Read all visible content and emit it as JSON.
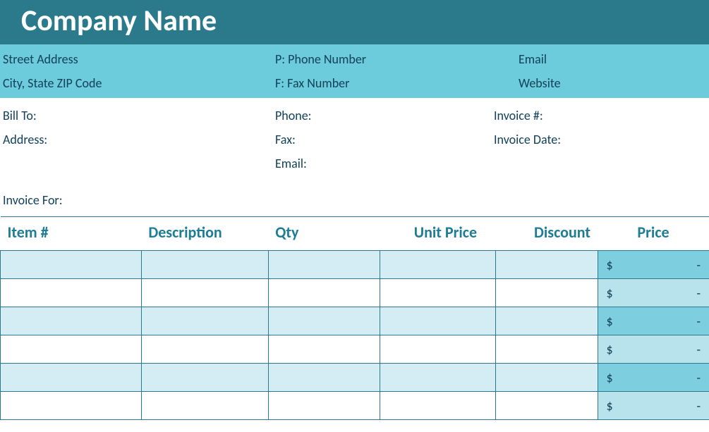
{
  "header": {
    "company": "Company Name"
  },
  "info": {
    "street": "Street Address",
    "phone": "P: Phone Number",
    "email": "Email",
    "city": "City, State ZIP Code",
    "fax": "F: Fax Number",
    "website": "Website"
  },
  "billto": {
    "billto": "Bill To:",
    "phone": "Phone:",
    "invoice_no": "Invoice #:",
    "address": "Address:",
    "fax": "Fax:",
    "invoice_date": "Invoice Date:",
    "email": "Email:"
  },
  "invoice_for": "Invoice For:",
  "table": {
    "headers": {
      "item": "Item #",
      "description": "Description",
      "qty": "Qty",
      "unit_price": "Unit Price",
      "discount": "Discount",
      "price": "Price"
    },
    "rows": [
      {
        "price_currency": "$",
        "price_value": "-"
      },
      {
        "price_currency": "$",
        "price_value": "-"
      },
      {
        "price_currency": "$",
        "price_value": "-"
      },
      {
        "price_currency": "$",
        "price_value": "-"
      },
      {
        "price_currency": "$",
        "price_value": "-"
      },
      {
        "price_currency": "$",
        "price_value": "-"
      }
    ]
  }
}
